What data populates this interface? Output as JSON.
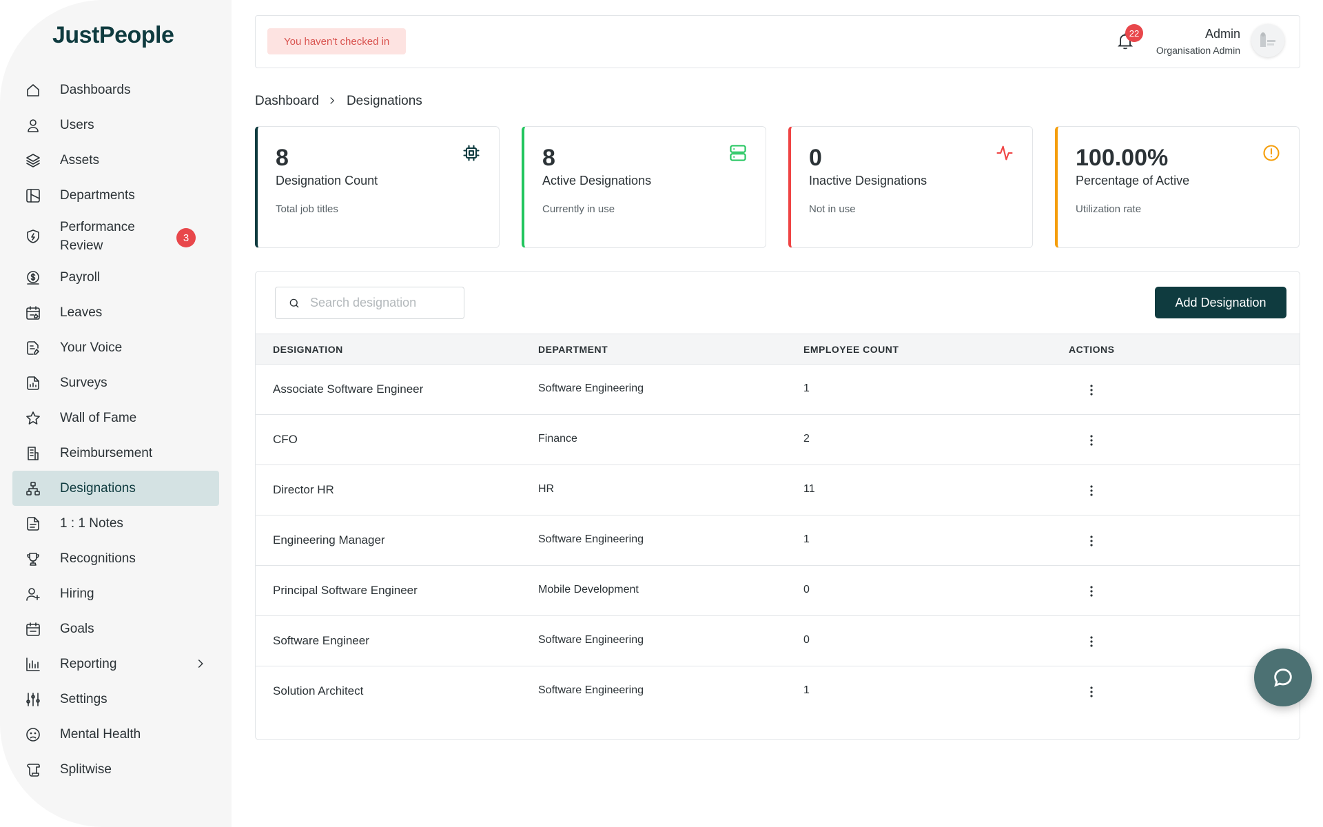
{
  "app": {
    "logo": "JustPeople"
  },
  "sidebar": {
    "items": [
      {
        "label": "Dashboards",
        "icon": "home-icon"
      },
      {
        "label": "Users",
        "icon": "user-icon"
      },
      {
        "label": "Assets",
        "icon": "layers-icon"
      },
      {
        "label": "Departments",
        "icon": "departments-icon"
      },
      {
        "label": "Performance Review",
        "icon": "shield-bolt-icon",
        "badge": "3"
      },
      {
        "label": "Payroll",
        "icon": "dollar-coin-icon"
      },
      {
        "label": "Leaves",
        "icon": "calendar-edit-icon"
      },
      {
        "label": "Your Voice",
        "icon": "document-edit-icon"
      },
      {
        "label": "Surveys",
        "icon": "document-chart-icon"
      },
      {
        "label": "Wall of Fame",
        "icon": "star-icon"
      },
      {
        "label": "Reimbursement",
        "icon": "receipt-icon"
      },
      {
        "label": "Designations",
        "icon": "hierarchy-icon",
        "active": true
      },
      {
        "label": "1 : 1 Notes",
        "icon": "notes-icon"
      },
      {
        "label": "Recognitions",
        "icon": "trophy-icon"
      },
      {
        "label": "Hiring",
        "icon": "user-add-icon"
      },
      {
        "label": "Goals",
        "icon": "calendar-check-icon"
      },
      {
        "label": "Reporting",
        "icon": "bar-chart-icon"
      },
      {
        "label": "Settings",
        "icon": "sliders-icon"
      },
      {
        "label": "Mental Health",
        "icon": "sad-face-icon"
      },
      {
        "label": "Splitwise",
        "icon": "scroll-icon"
      }
    ]
  },
  "header": {
    "checkin_text": "You haven't checked in",
    "notification_count": "22",
    "user_name": "Admin",
    "user_role": "Organisation Admin"
  },
  "breadcrumb": {
    "root": "Dashboard",
    "current": "Designations"
  },
  "stats": [
    {
      "value": "8",
      "label": "Designation Count",
      "sub": "Total job titles",
      "icon": "cpu-chip-icon",
      "color": "#0f3b3f"
    },
    {
      "value": "8",
      "label": "Active Designations",
      "sub": "Currently in use",
      "icon": "server-icon",
      "color": "#22c55e"
    },
    {
      "value": "0",
      "label": "Inactive Designations",
      "sub": "Not in use",
      "icon": "pulse-icon",
      "color": "#ef4444"
    },
    {
      "value": "100.00%",
      "label": "Percentage of Active",
      "sub": "Utilization rate",
      "icon": "alert-circle-icon",
      "color": "#f59e0b"
    }
  ],
  "table": {
    "search_placeholder": "Search designation",
    "add_label": "Add Designation",
    "columns": [
      "DESIGNATION",
      "DEPARTMENT",
      "EMPLOYEE COUNT",
      "ACTIONS"
    ],
    "rows": [
      {
        "designation": "Associate Software Engineer",
        "department": "Software Engineering",
        "count": "1"
      },
      {
        "designation": "CFO",
        "department": "Finance",
        "count": "2"
      },
      {
        "designation": "Director HR",
        "department": "HR",
        "count": "11"
      },
      {
        "designation": "Engineering Manager",
        "department": "Software Engineering",
        "count": "1"
      },
      {
        "designation": "Principal Software Engineer",
        "department": "Mobile Development",
        "count": "0"
      },
      {
        "designation": "Software Engineer",
        "department": "Software Engineering",
        "count": "0"
      },
      {
        "designation": "Solution Architect",
        "department": "Software Engineering",
        "count": "1"
      }
    ]
  }
}
